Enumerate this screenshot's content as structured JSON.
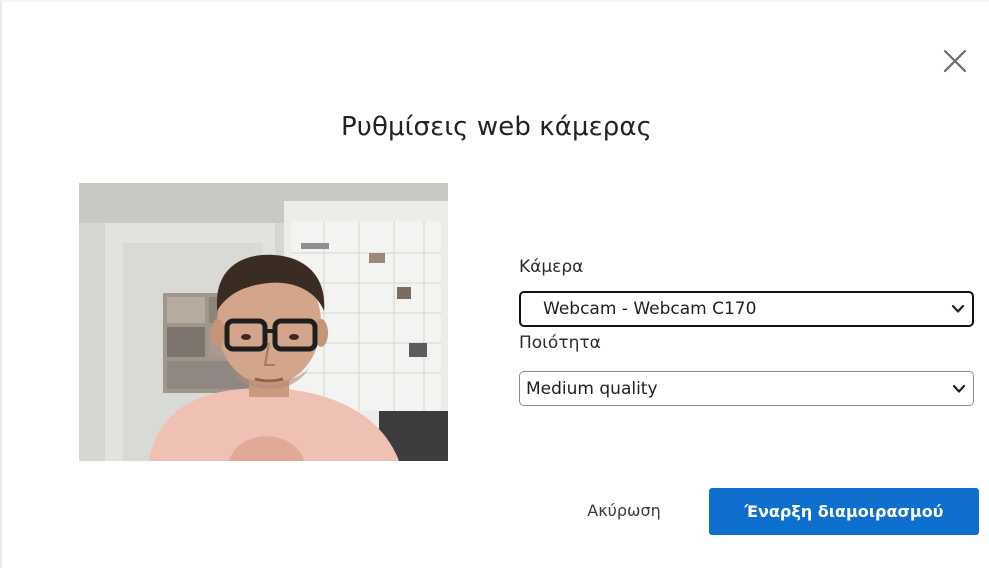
{
  "dialog": {
    "title": "Ρυθμίσεις web κάμερας",
    "close_icon": "close-icon"
  },
  "camera": {
    "label": "Κάμερα",
    "selected": "Webcam - Webcam C170"
  },
  "quality": {
    "label": "Ποιότητα",
    "selected": "Medium quality"
  },
  "actions": {
    "cancel_label": "Ακύρωση",
    "start_label": "Έναρξη διαμοιρασμού"
  },
  "colors": {
    "primary": "#0f6fce",
    "text": "#222222",
    "border_focus": "#141414",
    "border": "#8a8a8a"
  }
}
